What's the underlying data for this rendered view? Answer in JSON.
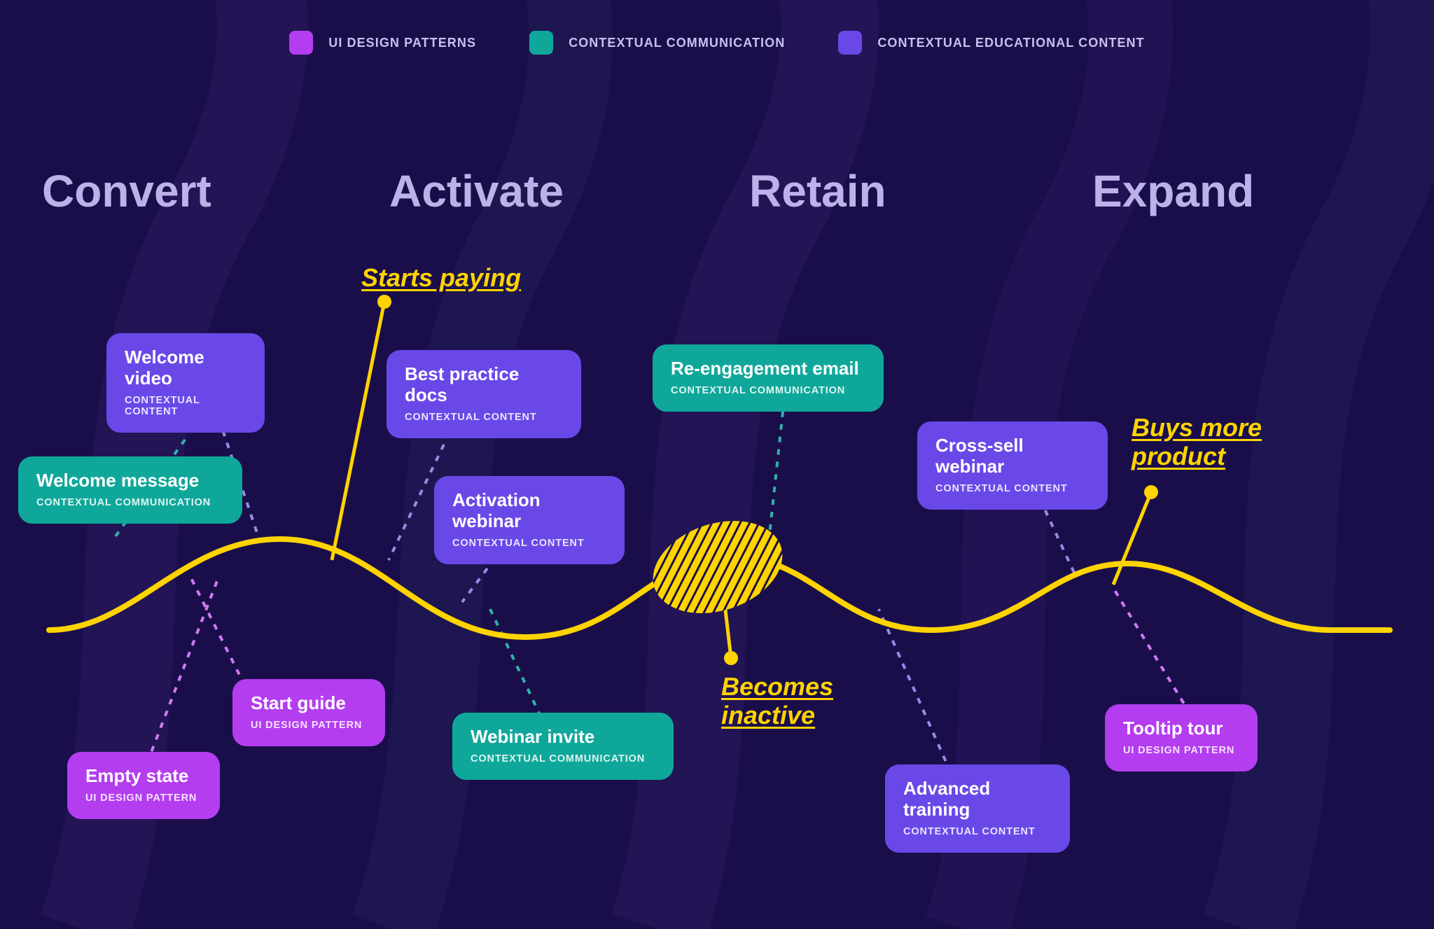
{
  "legend": [
    {
      "label": "UI DESIGN PATTERNS",
      "color": "#b43df0"
    },
    {
      "label": "CONTEXTUAL COMMUNICATION",
      "color": "#10a79b"
    },
    {
      "label": "CONTEXTUAL EDUCATIONAL CONTENT",
      "color": "#6a48e8"
    }
  ],
  "stages": {
    "convert": "Convert",
    "activate": "Activate",
    "retain": "Retain",
    "expand": "Expand"
  },
  "milestones": {
    "starts_paying": "Starts paying",
    "becomes_inactive": "Becomes\ninactive",
    "buys_more": "Buys more\nproduct"
  },
  "cards": {
    "welcome_video": {
      "title": "Welcome video",
      "sub": "CONTEXTUAL CONTENT"
    },
    "welcome_message": {
      "title": "Welcome message",
      "sub": "CONTEXTUAL COMMUNICATION"
    },
    "start_guide": {
      "title": "Start guide",
      "sub": "UI DESIGN PATTERN"
    },
    "empty_state": {
      "title": "Empty state",
      "sub": "UI DESIGN PATTERN"
    },
    "best_practice_docs": {
      "title": "Best practice docs",
      "sub": "CONTEXTUAL CONTENT"
    },
    "activation_webinar": {
      "title": "Activation webinar",
      "sub": "CONTEXTUAL CONTENT"
    },
    "webinar_invite": {
      "title": "Webinar invite",
      "sub": "CONTEXTUAL COMMUNICATION"
    },
    "reengagement_email": {
      "title": "Re-engagement email",
      "sub": "CONTEXTUAL COMMUNICATION"
    },
    "advanced_training": {
      "title": "Advanced training",
      "sub": "CONTEXTUAL CONTENT"
    },
    "cross_sell_webinar": {
      "title": "Cross-sell webinar",
      "sub": "CONTEXTUAL CONTENT"
    },
    "tooltip_tour": {
      "title": "Tooltip tour",
      "sub": "UI DESIGN PATTERN"
    }
  }
}
